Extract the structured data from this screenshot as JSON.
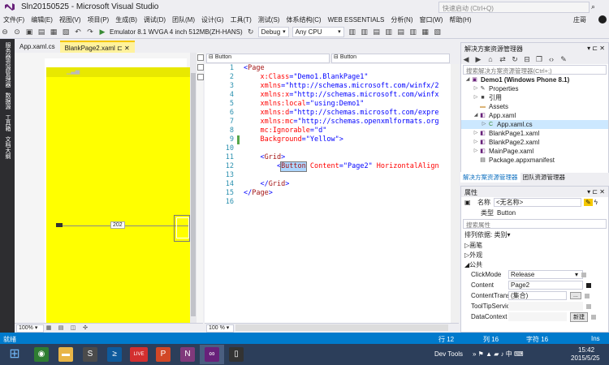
{
  "window": {
    "title": "Sln20150525 - Microsoft Visual Studio",
    "quick_launch_placeholder": "快速启动 (Ctrl+Q)"
  },
  "menu": [
    "文件(F)",
    "编辑(E)",
    "视图(V)",
    "项目(P)",
    "生成(B)",
    "调试(D)",
    "团队(M)",
    "设计(G)",
    "工具(T)",
    "测试(S)",
    "体系结构(C)",
    "WEB ESSENTIALS",
    "分析(N)",
    "窗口(W)",
    "帮助(H)"
  ],
  "user": {
    "name": "庄哥"
  },
  "toolbar": {
    "run_label": "Emulator 8.1 WVGA 4 inch 512MB(ZH-HANS)",
    "config": "Debug",
    "platform": "Any CPU"
  },
  "left_rail": [
    "服务器资源管理器",
    "数据源",
    "工具箱",
    "文档大纲"
  ],
  "doc_tabs": [
    {
      "label": "App.xaml.cs"
    },
    {
      "label": "BlankPage2.xaml"
    }
  ],
  "designer": {
    "dimension_label": "202",
    "zoom": "100%"
  },
  "editor": {
    "nav_left": "Button",
    "nav_right": "Button",
    "zoom": "100 %",
    "lines": [
      {
        "n": "1",
        "parts": [
          {
            "t": "<",
            "c": "pun"
          },
          {
            "t": "Page",
            "c": "tag"
          }
        ]
      },
      {
        "n": "2",
        "parts": [
          {
            "t": "    x:Class",
            "c": "attr"
          },
          {
            "t": "=",
            "c": "pun"
          },
          {
            "t": "\"Demo1.BlankPage1\"",
            "c": "val"
          }
        ]
      },
      {
        "n": "3",
        "parts": [
          {
            "t": "    xmlns",
            "c": "attr"
          },
          {
            "t": "=",
            "c": "pun"
          },
          {
            "t": "\"http://schemas.microsoft.com/winfx/2",
            "c": "val"
          }
        ]
      },
      {
        "n": "4",
        "parts": [
          {
            "t": "    xmlns:x",
            "c": "attr"
          },
          {
            "t": "=",
            "c": "pun"
          },
          {
            "t": "\"http://schemas.microsoft.com/winfx",
            "c": "val"
          }
        ]
      },
      {
        "n": "5",
        "parts": [
          {
            "t": "    xmlns:local",
            "c": "attr"
          },
          {
            "t": "=",
            "c": "pun"
          },
          {
            "t": "\"using:Demo1\"",
            "c": "val"
          }
        ]
      },
      {
        "n": "6",
        "parts": [
          {
            "t": "    xmlns:d",
            "c": "attr"
          },
          {
            "t": "=",
            "c": "pun"
          },
          {
            "t": "\"http://schemas.microsoft.com/expre",
            "c": "val"
          }
        ]
      },
      {
        "n": "7",
        "parts": [
          {
            "t": "    xmlns:mc",
            "c": "attr"
          },
          {
            "t": "=",
            "c": "pun"
          },
          {
            "t": "\"http://schemas.openxmlformats.org",
            "c": "val"
          }
        ]
      },
      {
        "n": "8",
        "parts": [
          {
            "t": "    mc:Ignorable",
            "c": "attr"
          },
          {
            "t": "=",
            "c": "pun"
          },
          {
            "t": "\"d\"",
            "c": "val"
          }
        ]
      },
      {
        "n": "9",
        "parts": [
          {
            "t": "    Background",
            "c": "attr"
          },
          {
            "t": "=",
            "c": "pun"
          },
          {
            "t": "\"Yellow\"",
            "c": "val"
          },
          {
            "t": ">",
            "c": "pun"
          }
        ]
      },
      {
        "n": "10",
        "parts": []
      },
      {
        "n": "11",
        "parts": [
          {
            "t": "    <",
            "c": "pun"
          },
          {
            "t": "Grid",
            "c": "tag"
          },
          {
            "t": ">",
            "c": "pun"
          }
        ]
      },
      {
        "n": "12",
        "parts": [
          {
            "t": "        <",
            "c": "pun"
          },
          {
            "t": "Button",
            "c": "tag"
          },
          {
            "t": " Content",
            "c": "attr"
          },
          {
            "t": "=",
            "c": "pun"
          },
          {
            "t": "\"Page2\"",
            "c": "val"
          },
          {
            "t": " HorizontalAlign",
            "c": "attr"
          }
        ]
      },
      {
        "n": "13",
        "parts": []
      },
      {
        "n": "14",
        "parts": [
          {
            "t": "    </",
            "c": "pun"
          },
          {
            "t": "Grid",
            "c": "tag"
          },
          {
            "t": ">",
            "c": "pun"
          }
        ]
      },
      {
        "n": "15",
        "parts": [
          {
            "t": "</",
            "c": "pun"
          },
          {
            "t": "Page",
            "c": "tag"
          },
          {
            "t": ">",
            "c": "pun"
          }
        ]
      },
      {
        "n": "16",
        "parts": []
      }
    ]
  },
  "solution_explorer": {
    "title": "解决方案资源管理器",
    "search_placeholder": "搜索解决方案资源管理器(Ctrl+;)",
    "items": [
      {
        "label": "Demo1 (Windows Phone 8.1)",
        "icon": "project-icon",
        "level": 0,
        "arrow": "◢",
        "bold": true
      },
      {
        "label": "Properties",
        "icon": "wrench-icon",
        "level": 1,
        "arrow": "▷"
      },
      {
        "label": "引用",
        "icon": "references-icon",
        "level": 1,
        "arrow": "▷"
      },
      {
        "label": "Assets",
        "icon": "folder-icon",
        "level": 1,
        "arrow": ""
      },
      {
        "label": "App.xaml",
        "icon": "xaml-icon",
        "level": 1,
        "arrow": "◢"
      },
      {
        "label": "App.xaml.cs",
        "icon": "csharp-icon",
        "level": 2,
        "arrow": "▷",
        "selected": true
      },
      {
        "label": "BlankPage1.xaml",
        "icon": "xaml-icon",
        "level": 1,
        "arrow": "▷"
      },
      {
        "label": "BlankPage2.xaml",
        "icon": "xaml-icon",
        "level": 1,
        "arrow": "▷"
      },
      {
        "label": "MainPage.xaml",
        "icon": "xaml-icon",
        "level": 1,
        "arrow": "▷"
      },
      {
        "label": "Package.appxmanifest",
        "icon": "manifest-icon",
        "level": 1,
        "arrow": ""
      }
    ],
    "tabs": [
      "解决方案资源管理器",
      "团队资源管理器"
    ]
  },
  "properties": {
    "title": "属性",
    "name_label": "名称",
    "name_value": "<无名称>",
    "type_label": "类型",
    "type_value": "Button",
    "search_placeholder": "搜索属性",
    "sort_label": "排列依据: 类别",
    "categories": [
      "画笔",
      "外观",
      "公共"
    ],
    "rows": [
      {
        "label": "ClickMode",
        "value": "Release",
        "dropdown": true
      },
      {
        "label": "Content",
        "value": "Page2"
      },
      {
        "label": "ContentTransi...",
        "value": "(集合)",
        "button": "..."
      },
      {
        "label": "ToolTipServic...",
        "value": ""
      },
      {
        "label": "DataContext",
        "value": "",
        "button": "新建"
      }
    ]
  },
  "status": {
    "ready": "就绪",
    "line": "行 12",
    "col": "列 16",
    "char": "字符 16",
    "mode": "Ins"
  },
  "taskbar": {
    "apps": [
      "windows-icon",
      "chrome-icon",
      "explorer-icon",
      "sublime-icon",
      "powershell-icon",
      "live-icon",
      "powerpoint-icon",
      "onenote-icon",
      "visualstudio-icon",
      "phone-icon"
    ],
    "dev_tools": "Dev Tools",
    "time": "15:42",
    "date": "2015/5/25"
  },
  "colors": {
    "accent": "#007ACC",
    "vs_purple": "#68217A",
    "active_tab": "#FFF29D",
    "design_surface": "#FFFF00"
  }
}
